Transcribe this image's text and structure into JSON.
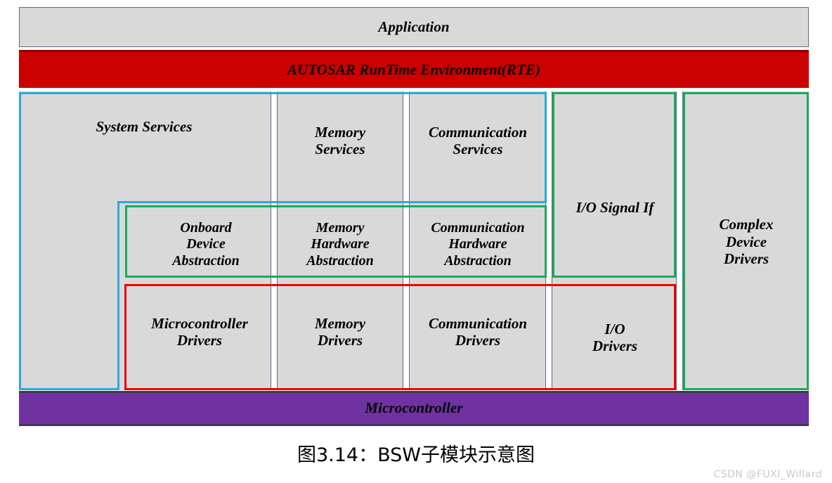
{
  "figure": {
    "caption": "图3.14：BSW子模块示意图",
    "watermark": "CSDN @FUXI_Willard"
  },
  "layers": {
    "application": "Application",
    "rte": "AUTOSAR RunTime Environment(RTE)",
    "microcontroller": "Microcontroller"
  },
  "services_row": {
    "system_services": "System Services",
    "memory_services": "Memory\nServices",
    "communication_services": "Communication\nServices"
  },
  "abstraction_row": {
    "onboard_device_abstraction": "Onboard\nDevice\nAbstraction",
    "memory_hardware_abstraction": "Memory\nHardware\nAbstraction",
    "communication_hardware_abstraction": "Communication\nHardware\nAbstraction"
  },
  "drivers_row": {
    "microcontroller_drivers": "Microcontroller\nDrivers",
    "memory_drivers": "Memory\nDrivers",
    "communication_drivers": "Communication\nDrivers",
    "io_drivers": "I/O\nDrivers"
  },
  "spanning_columns": {
    "io_signal_if": "I/O Signal If",
    "complex_device_drivers": "Complex\nDevice\nDrivers"
  },
  "colors": {
    "cell_fill": "#d9d9d9",
    "rte_red": "#cc0000",
    "rte_red_dark": "#8f0000",
    "microcontroller_purple": "#6f32a0",
    "services_group_cyan": "#2ca8dc",
    "abstraction_group_green": "#1aaa5a",
    "drivers_group_red": "#ee0000",
    "cell_border_blue": "#5b6b85",
    "watermark_gray": "#c9c9cf"
  }
}
